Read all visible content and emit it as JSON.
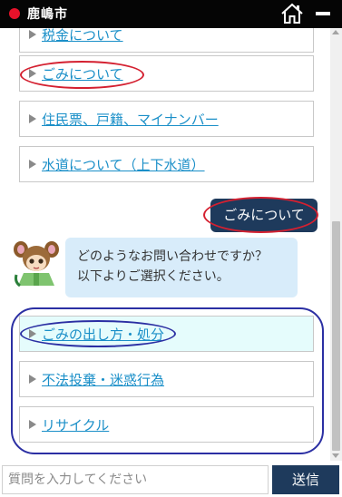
{
  "header": {
    "title": "鹿嶋市",
    "icons": {
      "status_dot": "red-dot-icon",
      "home": "home-icon",
      "minimize": "minimize-icon"
    }
  },
  "chat": {
    "previous_options": [
      {
        "label": "税金について"
      },
      {
        "label": "ごみについて"
      },
      {
        "label": "住民票、戸籍、マイナンバー"
      },
      {
        "label": "水道について（上下水道）"
      }
    ],
    "user_message": "ごみについて",
    "bot_message": {
      "avatar": "mascot-avatar-icon",
      "line1": "どのようなお問い合わせですか？",
      "line2": "以下よりご選択ください。"
    },
    "options": [
      {
        "label": "ごみの出し方・処分"
      },
      {
        "label": "不法投棄・迷惑行為"
      },
      {
        "label": "リサイクル"
      }
    ]
  },
  "input": {
    "placeholder": "質問を入力してください",
    "send_label": "送信"
  },
  "colors": {
    "header_bg": "#050505",
    "accent_navy": "#1e3a5c",
    "link_blue": "#1a8fc8",
    "annotation_red": "#d42030",
    "annotation_blue": "#2b2fa3",
    "bot_bubble": "#d8ecfa",
    "highlight_option": "#e5fcfc"
  }
}
